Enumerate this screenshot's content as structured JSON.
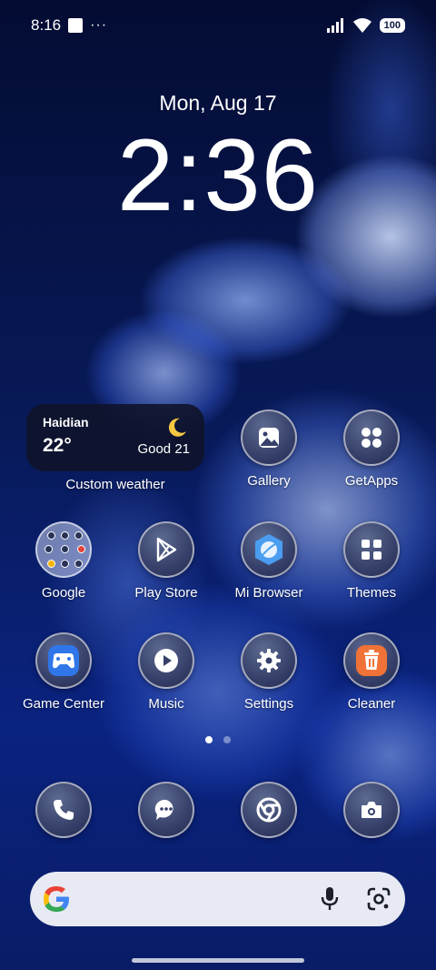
{
  "status_bar": {
    "time": "8:16",
    "dots": "···",
    "battery": "100"
  },
  "lockscreen": {
    "date": "Mon, Aug 17",
    "time": "2:36"
  },
  "weather_widget": {
    "city": "Haidian",
    "temperature": "22°",
    "air_quality": "Good 21",
    "label": "Custom weather"
  },
  "apps": {
    "gallery": "Gallery",
    "getapps": "GetApps",
    "google": "Google",
    "play_store": "Play Store",
    "mi_browser": "Mi Browser",
    "themes": "Themes",
    "game_center": "Game Center",
    "music": "Music",
    "settings": "Settings",
    "cleaner": "Cleaner"
  },
  "dock": {
    "items": [
      "phone-icon",
      "messages-icon",
      "chrome-icon",
      "camera-icon"
    ]
  },
  "page_indicator": {
    "pages": 2,
    "current": 1
  },
  "search": {
    "icons": [
      "google-logo-icon",
      "microphone-icon",
      "google-lens-icon"
    ]
  },
  "colors": {
    "cleaner_orange": "#f07236",
    "mi_browser_blue": "#4a9df0",
    "game_center_blue": "#2f76e8",
    "search_bar_bg": "#e7eaf3",
    "widget_bg": "#0f142a"
  }
}
